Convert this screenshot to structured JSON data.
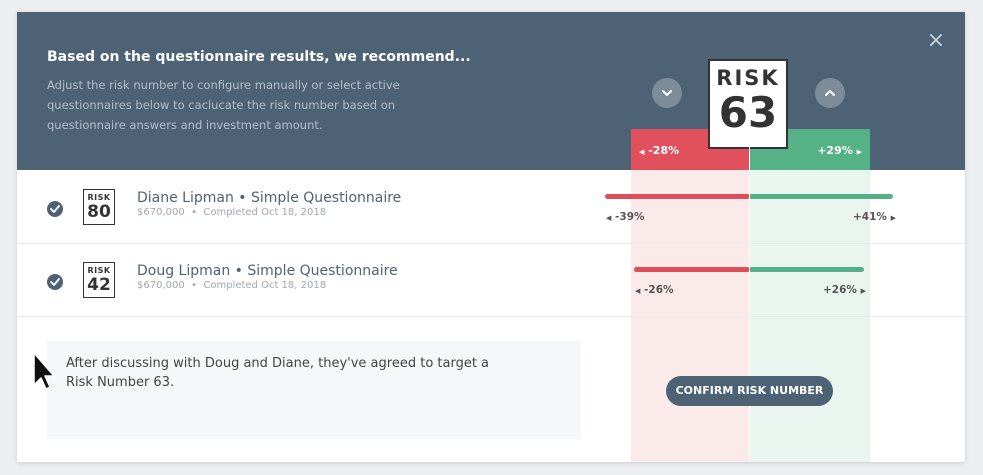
{
  "header": {
    "title": "Based on the questionnaire results, we recommend...",
    "description": "Adjust the risk number to configure manually or select active questionnaires below to caclucate the risk number based on questionnaire answers and investment amount."
  },
  "risk": {
    "label": "RISK",
    "number": "63",
    "range_low": "-28%",
    "range_high": "+29%"
  },
  "icons": {
    "close": "close-icon",
    "decrease": "chevron-down-icon",
    "increase": "chevron-up-icon",
    "check": "check-icon"
  },
  "questionnaires": [
    {
      "name": "Diane Lipman • Simple Questionnaire",
      "amount": "$670,000",
      "status": "Completed Oct 18, 2018",
      "badge_label": "RISK",
      "risk_number": "80",
      "low": "-39%",
      "high": "+41%"
    },
    {
      "name": "Doug Lipman • Simple Questionnaire",
      "amount": "$670,000",
      "status": "Completed Oct 18, 2018",
      "badge_label": "RISK",
      "risk_number": "42",
      "low": "-26%",
      "high": "+26%"
    }
  ],
  "note": {
    "text": "After discussing with Doug and Diane, they've agreed to target a Risk Number 63."
  },
  "actions": {
    "confirm_label": "CONFIRM RISK NUMBER"
  },
  "colors": {
    "header_bg": "#4e6275",
    "negative": "#e0505d",
    "positive": "#55b186",
    "negative_band": "#fbeaea",
    "positive_band": "#eaf5ef"
  }
}
